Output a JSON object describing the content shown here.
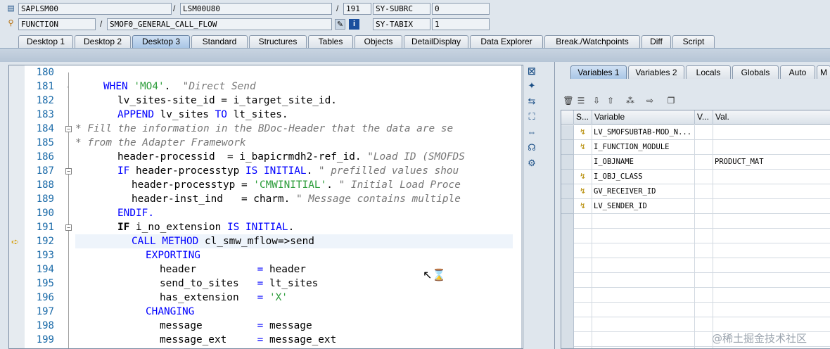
{
  "header": {
    "row1": {
      "program": "SAPLSM00",
      "include": "LSM00U80",
      "line": "191",
      "sy_label": "SY-SUBRC",
      "sy_value": "0"
    },
    "row2": {
      "type": "FUNCTION",
      "name": "SMOF0_GENERAL_CALL_FLOW",
      "sy_label": "SY-TABIX",
      "sy_value": "1"
    },
    "sep": "/"
  },
  "tabs": [
    "Desktop 1",
    "Desktop 2",
    "Desktop 3",
    "Standard",
    "Structures",
    "Tables",
    "Objects",
    "DetailDisplay",
    "Data Explorer",
    "Break./Watchpoints",
    "Diff",
    "Script"
  ],
  "active_tab": "Desktop 3",
  "code": {
    "current_line": "192",
    "lines": [
      {
        "n": "180",
        "text": ""
      },
      {
        "n": "181",
        "text": "WHEN 'MO4'.  \"Direct Send"
      },
      {
        "n": "182",
        "text": "lv_sites-site_id = i_target_site_id."
      },
      {
        "n": "183",
        "text": "APPEND lv_sites TO lt_sites."
      },
      {
        "n": "184",
        "text": "* Fill the information in the BDoc-Header that the data are se"
      },
      {
        "n": "185",
        "text": "* from the Adapter Framework"
      },
      {
        "n": "186",
        "text": "header-processid  = i_bapicrmdh2-ref_id. \"Load ID (SMOFDS"
      },
      {
        "n": "187",
        "text": "IF header-processtyp IS INITIAL. \" prefilled values shou"
      },
      {
        "n": "188",
        "text": "header-processtyp = 'CMWINITIAL'. \" Initial Load Proce"
      },
      {
        "n": "189",
        "text": "header-inst_ind   = charm. \" Message contains multiple"
      },
      {
        "n": "190",
        "text": "ENDIF."
      },
      {
        "n": "191",
        "text": "IF i_no_extension IS INITIAL."
      },
      {
        "n": "192",
        "text": "CALL METHOD cl_smw_mflow=>send"
      },
      {
        "n": "193",
        "text": "EXPORTING"
      },
      {
        "n": "194",
        "text": "header          = header"
      },
      {
        "n": "195",
        "text": "send_to_sites   = lt_sites"
      },
      {
        "n": "196",
        "text": "has_extension   = 'X'"
      },
      {
        "n": "197",
        "text": "CHANGING"
      },
      {
        "n": "198",
        "text": "message         = message"
      },
      {
        "n": "199",
        "text": "message_ext     = message_ext"
      }
    ]
  },
  "right_tabs": [
    "Variables 1",
    "Variables 2",
    "Locals",
    "Globals",
    "Auto",
    "M"
  ],
  "right_active_tab": "Variables 1",
  "grid": {
    "headers": {
      "s": "S...",
      "variable": "Variable",
      "v": "V...",
      "val": "Val."
    },
    "rows": [
      {
        "variable": "LV_SMOFSUBTAB-MOD_N...",
        "val": "",
        "icon": "variable-icon"
      },
      {
        "variable": "I_FUNCTION_MODULE",
        "val": "",
        "icon": "variable-icon"
      },
      {
        "variable": "I_OBJNAME",
        "val": "PRODUCT_MAT",
        "icon": ""
      },
      {
        "variable": "I_OBJ_CLASS",
        "val": "",
        "icon": "variable-icon"
      },
      {
        "variable": "GV_RECEIVER_ID",
        "val": "",
        "icon": "variable-icon"
      },
      {
        "variable": "LV_SENDER_ID",
        "val": "",
        "icon": "variable-icon"
      }
    ]
  },
  "watermark": "@稀土掘金技术社区",
  "colors": {
    "accent": "#1a6aa8",
    "keyword": "#0000ff",
    "string": "#2d9d3b",
    "comment": "#777777"
  }
}
